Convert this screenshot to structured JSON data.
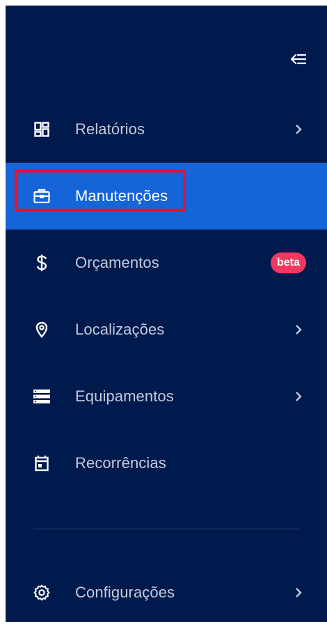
{
  "sidebar": {
    "collapse_icon": "collapse-left-icon",
    "items": [
      {
        "label": "Relatórios",
        "icon": "dashboard-icon",
        "has_chevron": true
      },
      {
        "label": "Manutenções",
        "icon": "toolbox-icon",
        "active": true
      },
      {
        "label": "Orçamentos",
        "icon": "dollar-icon",
        "badge": "beta"
      },
      {
        "label": "Localizações",
        "icon": "location-pin-icon",
        "has_chevron": true
      },
      {
        "label": "Equipamentos",
        "icon": "server-icon",
        "has_chevron": true
      },
      {
        "label": "Recorrências",
        "icon": "calendar-icon"
      }
    ],
    "footer_items": [
      {
        "label": "Configurações",
        "icon": "gear-icon",
        "has_chevron": true
      }
    ]
  },
  "colors": {
    "sidebar_bg": "#001a4d",
    "active_bg": "#1565d8",
    "text": "#c4cbdc",
    "badge_bg": "#f2385f",
    "highlight_border": "#e8102a"
  }
}
